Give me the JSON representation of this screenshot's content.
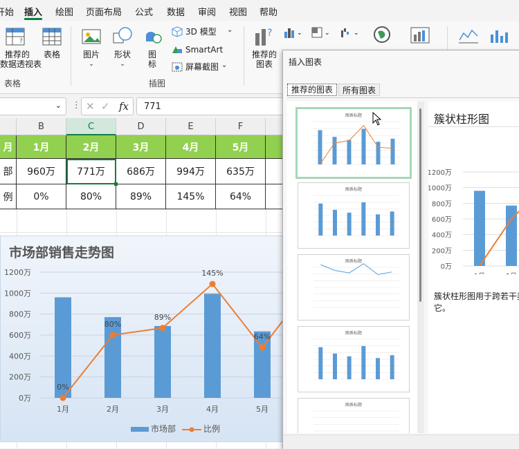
{
  "menu": {
    "items": [
      "开始",
      "插入",
      "绘图",
      "页面布局",
      "公式",
      "数据",
      "审阅",
      "视图",
      "帮助"
    ],
    "active": "插入"
  },
  "ribbon": {
    "pivot_label": "推荐的\n数据透视表",
    "table_label": "表格",
    "group_table": "表格",
    "picture_label": "图片",
    "shapes_label": "形状",
    "icons_label": "图\n标",
    "model3d_label": "3D 模型",
    "smartart_label": "SmartArt",
    "screenshot_label": "屏幕截图",
    "group_illustrations": "插图",
    "recommended_charts_label": "推荐的\n图表"
  },
  "formula_bar": {
    "fx": "fx",
    "value": "771",
    "cancel": "✕",
    "confirm": "✓"
  },
  "sheet": {
    "columns": [
      "B",
      "C",
      "D",
      "E",
      "F"
    ],
    "selected_column": "C",
    "header_row": [
      "1月",
      "2月",
      "3月",
      "4月",
      "5月"
    ],
    "row1_label": "部",
    "row1": [
      "960万",
      "771万",
      "686万",
      "994万",
      "635万"
    ],
    "row2_label": "例",
    "row2": [
      "0%",
      "80%",
      "89%",
      "145%",
      "64%"
    ],
    "a_header": "月"
  },
  "chart_data": {
    "type": "bar",
    "title": "市场部销售走势图",
    "categories": [
      "1月",
      "2月",
      "3月",
      "4月",
      "5月"
    ],
    "series": [
      {
        "name": "市场部",
        "type": "bar",
        "values": [
          960,
          771,
          686,
          994,
          635
        ],
        "color": "#5b9bd5"
      },
      {
        "name": "比例",
        "type": "line",
        "values": [
          0,
          80,
          89,
          145,
          64
        ],
        "labels": [
          "0%",
          "80%",
          "89%",
          "145%",
          "64%"
        ],
        "color": "#ed7d31"
      }
    ],
    "y_ticks": [
      "0万",
      "200万",
      "400万",
      "600万",
      "800万",
      "1000万",
      "1200万"
    ],
    "ylim": [
      0,
      1200
    ],
    "secondary_ylim": [
      0,
      160
    ],
    "legend_position": "bottom"
  },
  "dialog": {
    "title": "插入图表",
    "tabs": [
      "推荐的图表",
      "所有图表"
    ],
    "active_tab": "推荐的图表",
    "preview_title": "簇状柱形图",
    "preview_y_ticks": [
      "0万",
      "200万",
      "400万",
      "600万",
      "800万",
      "1000万",
      "1200万"
    ],
    "preview_x": [
      "1月",
      "2月"
    ],
    "description": "簇状柱形图用于跨若干类\n它。",
    "thumb_title": "图表标题"
  }
}
